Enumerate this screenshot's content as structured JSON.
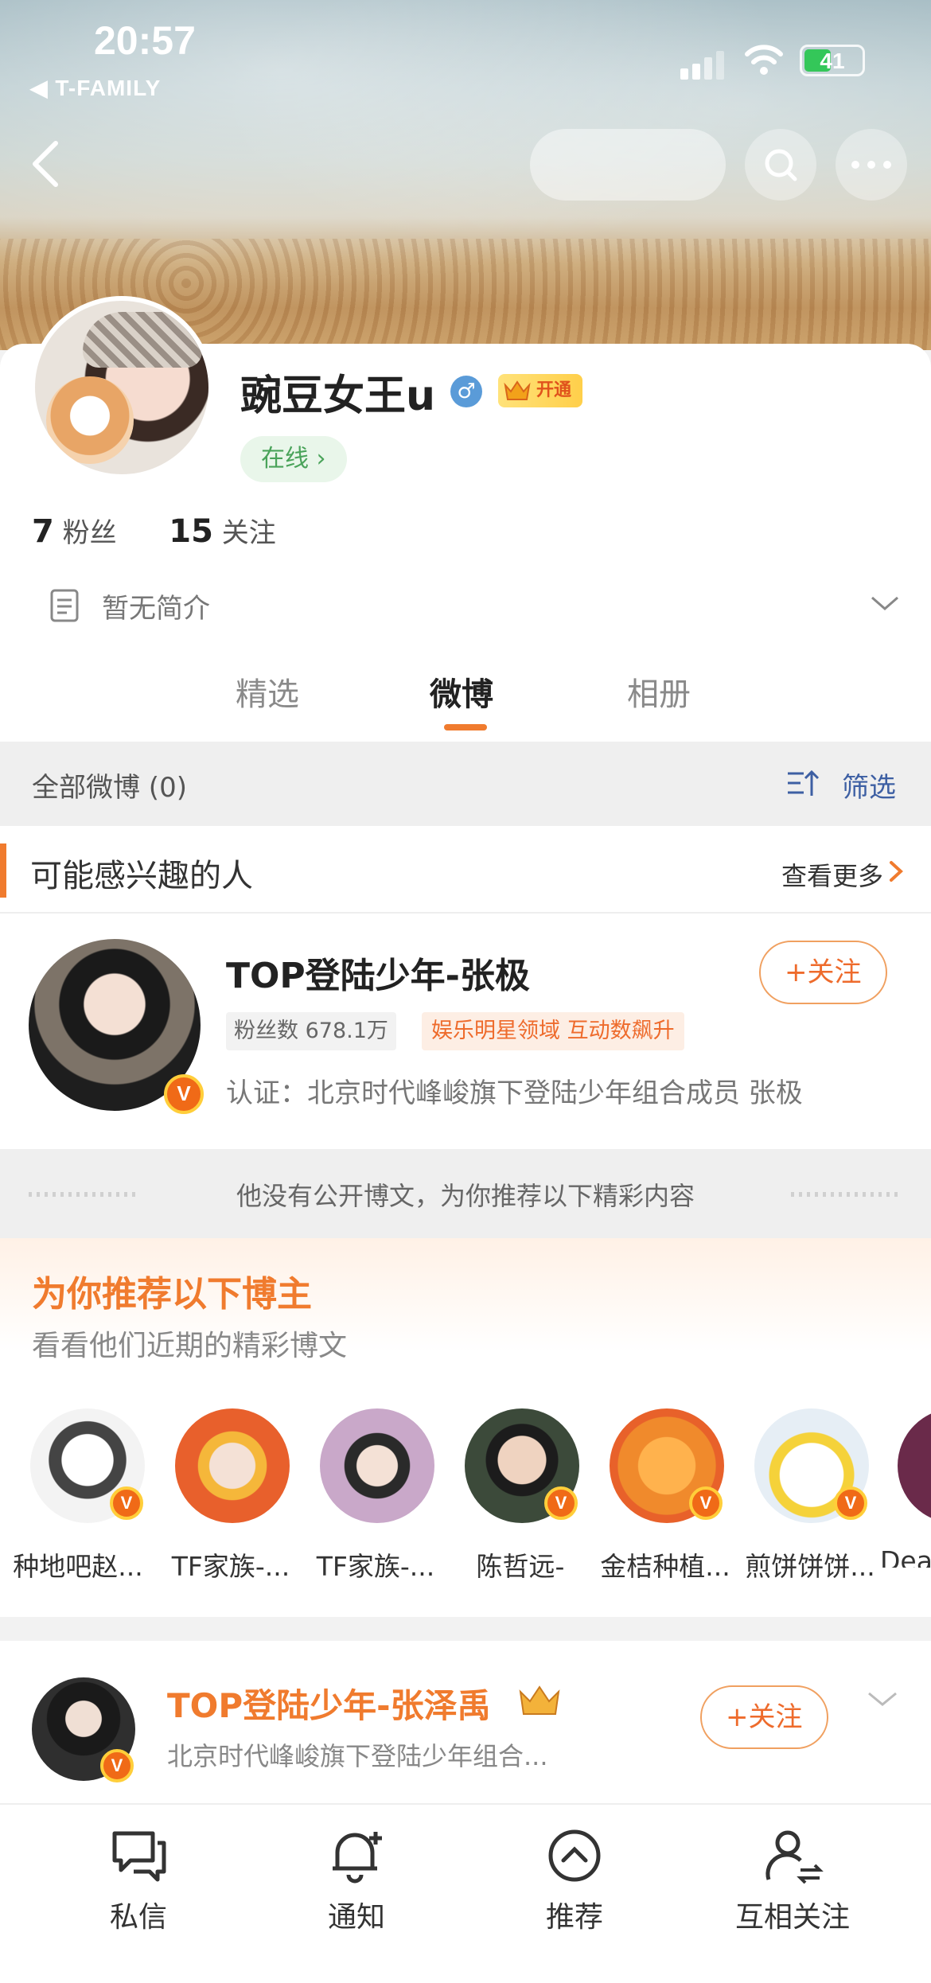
{
  "status_bar": {
    "time": "20:57",
    "carrier": "◀ T-FAMILY",
    "battery": "41"
  },
  "profile": {
    "name": "豌豆女王u",
    "gender_symbol": "♂",
    "vip_label": "开通",
    "online": "在线 ›",
    "fans_count": "7",
    "fans_label": "粉丝",
    "following_count": "15",
    "following_label": "关注",
    "bio": "暂无简介"
  },
  "tabs": [
    {
      "label": "精选"
    },
    {
      "label": "微博"
    },
    {
      "label": "相册"
    }
  ],
  "feed_header": {
    "count_label": "全部微博 (0)",
    "filter_label": "筛选"
  },
  "interest": {
    "title": "可能感兴趣的人",
    "more_label": "查看更多",
    "person": {
      "name": "TOP登陆少年-张极",
      "fans_tag": "粉丝数 678.1万",
      "domain_tag": "娱乐明星领域 互动数飙升",
      "verification": "认证：北京时代峰峻旗下登陆少年组合成员 张极",
      "follow_label": "+关注",
      "badge": "V"
    }
  },
  "notice": {
    "text": "他没有公开博文，为你推荐以下精彩内容"
  },
  "recommend": {
    "title": "为你推荐以下博主",
    "subtitle": "看看他们近期的精彩博文",
    "bloggers": [
      {
        "name": "种地吧赵...",
        "badge": "V"
      },
      {
        "name": "TF家族-...",
        "badge": ""
      },
      {
        "name": "TF家族-...",
        "badge": ""
      },
      {
        "name": "陈哲远-",
        "badge": "V"
      },
      {
        "name": "金桔种植...",
        "badge": "V"
      },
      {
        "name": "煎饼饼饼...",
        "badge": "V"
      },
      {
        "name": "Dea",
        "badge": ""
      }
    ]
  },
  "suggest": {
    "name": "TOP登陆少年-张泽禹",
    "desc": "北京时代峰峻旗下登陆少年组合...",
    "follow_label": "+关注",
    "badge": "V"
  },
  "bottom_bar": [
    {
      "label": "私信",
      "icon": "message-icon"
    },
    {
      "label": "通知",
      "icon": "bell-icon"
    },
    {
      "label": "推荐",
      "icon": "recommend-icon"
    },
    {
      "label": "互相关注",
      "icon": "mutual-follow-icon"
    }
  ],
  "colors": {
    "accent": "#f07b2e",
    "link": "#3d5fa3",
    "online": "#4aa35a"
  }
}
